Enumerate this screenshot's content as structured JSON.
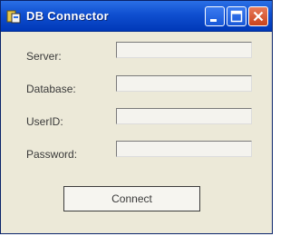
{
  "window": {
    "title": "DB Connector",
    "icon": "database-app-icon"
  },
  "titlebar_buttons": {
    "minimize_icon": "minimize-icon",
    "maximize_icon": "maximize-icon",
    "close_icon": "close-icon"
  },
  "form": {
    "server": {
      "label": "Server:",
      "value": ""
    },
    "database": {
      "label": "Database:",
      "value": ""
    },
    "userid": {
      "label": "UserID:",
      "value": ""
    },
    "password": {
      "label": "Password:",
      "value": ""
    }
  },
  "connect_label": "Connect",
  "colors": {
    "titlebar": "#0f4fd0",
    "window_body": "#ece9d8",
    "close_button": "#c9431c"
  }
}
